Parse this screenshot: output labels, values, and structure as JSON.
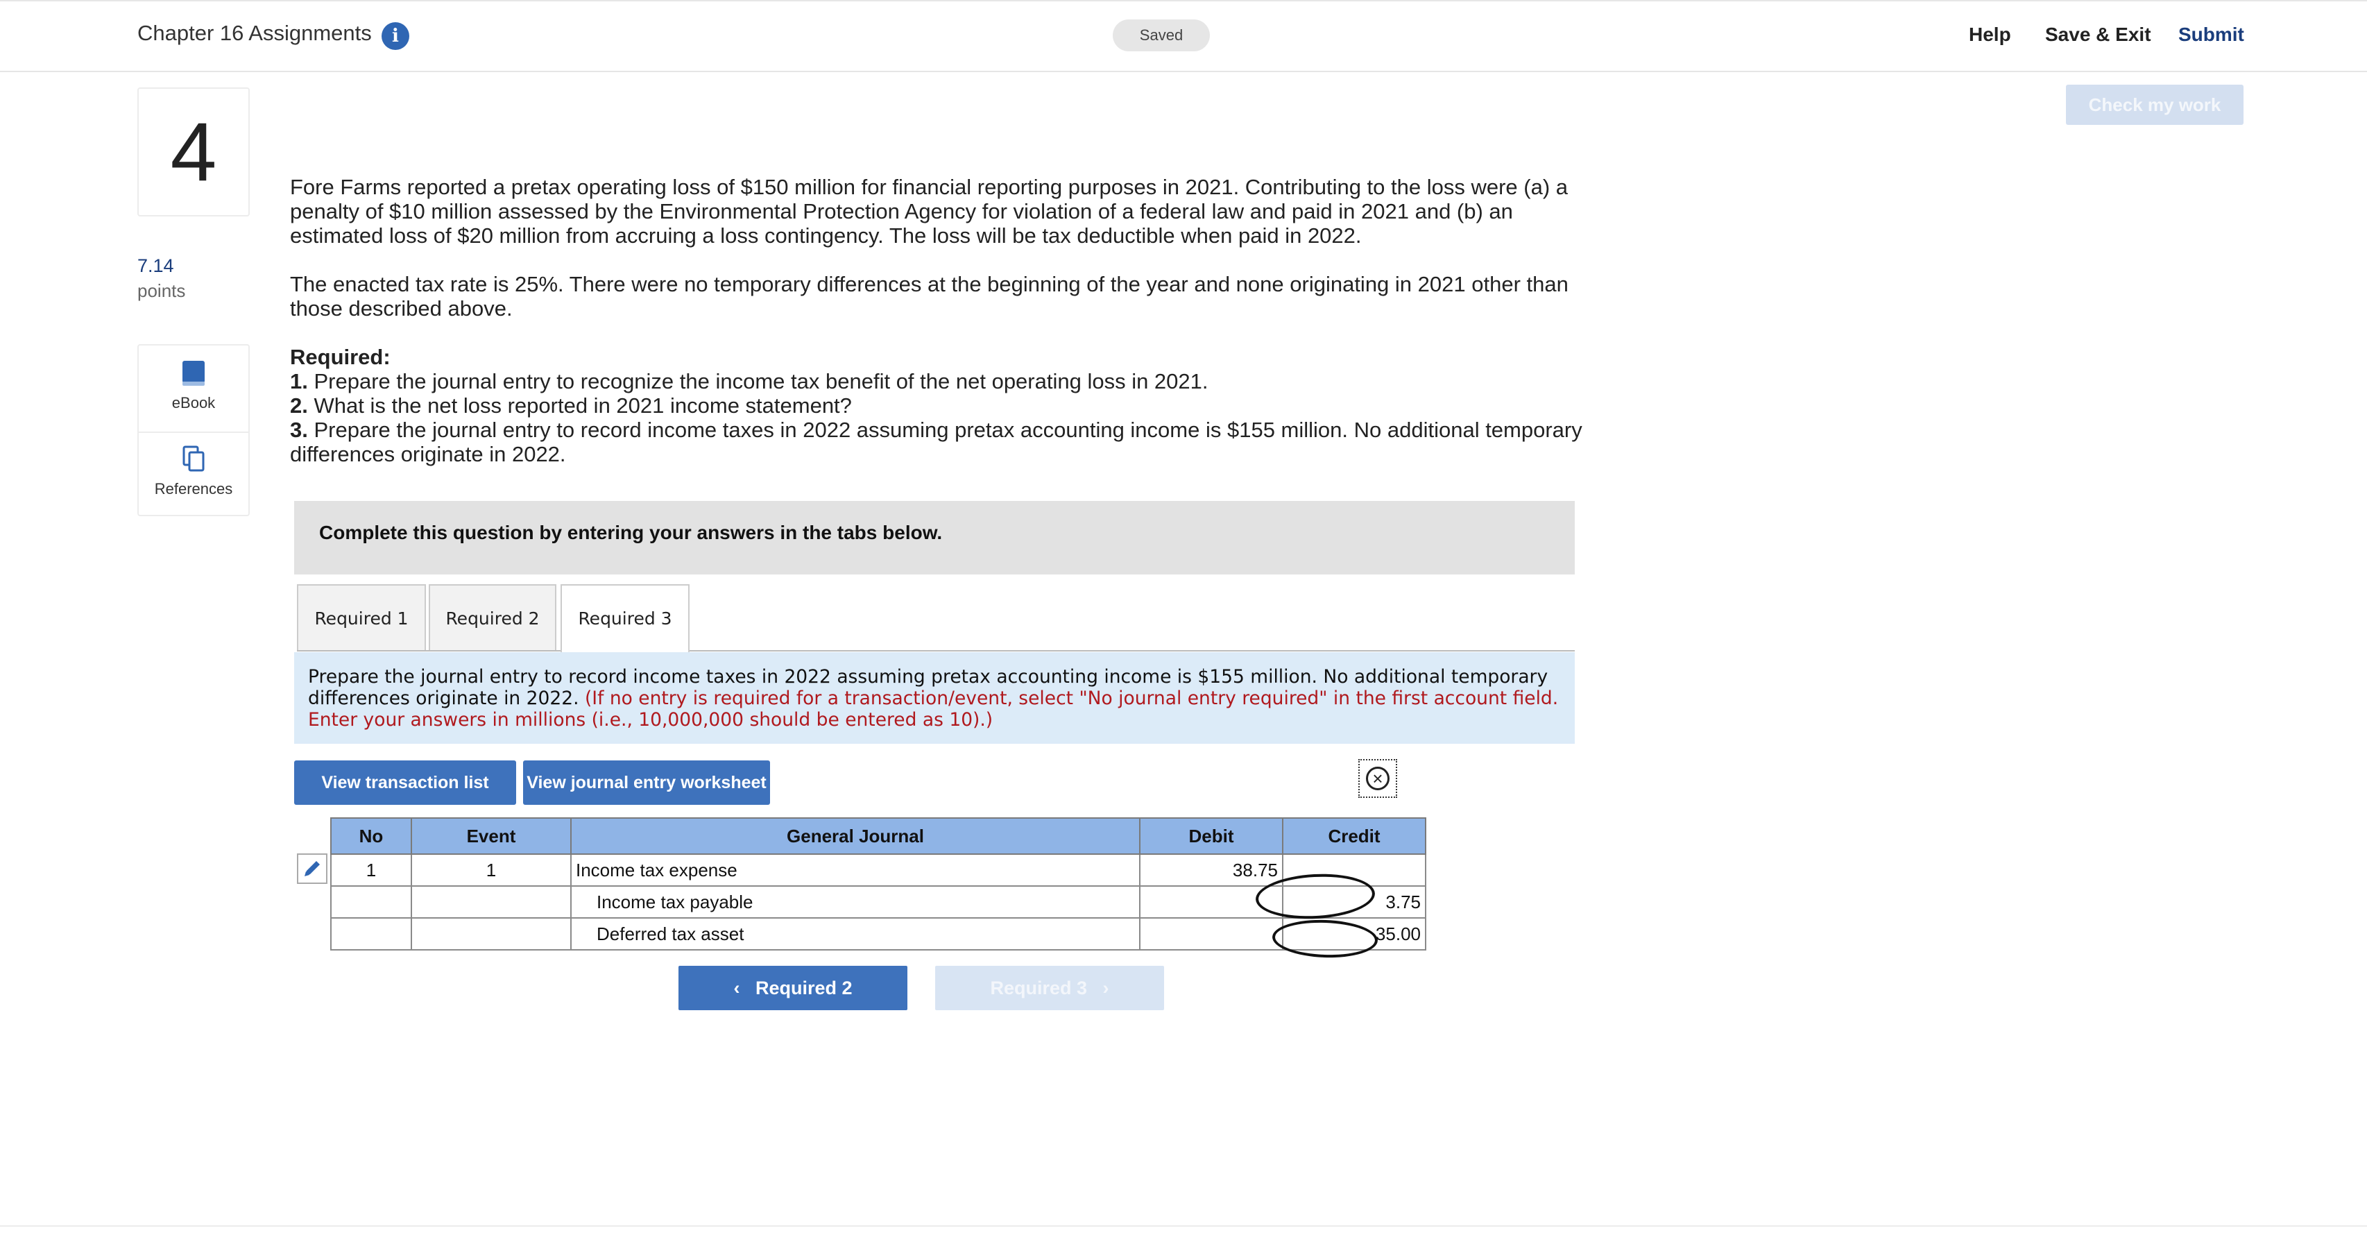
{
  "header": {
    "title": "Chapter 16 Assignments",
    "saved": "Saved",
    "help": "Help",
    "save_exit": "Save & Exit",
    "submit": "Submit"
  },
  "check_my_work": "Check my work",
  "question": {
    "number": "4",
    "points_value": "7.14",
    "points_label": "points",
    "tools": {
      "ebook": "eBook",
      "references": "References"
    },
    "para1": "Fore Farms reported a pretax operating loss of $150 million for financial reporting purposes in 2021. Contributing to the loss were (a) a penalty of $10 million assessed by the Environmental Protection Agency for violation of a federal law and paid in 2021 and (b) an estimated loss of $20 million from accruing a loss contingency. The loss will be tax deductible when paid in 2022.",
    "para2": "The enacted tax rate is 25%. There were no temporary differences at the beginning of the year and none originating in 2021 other than those described above.",
    "required_label": "Required:",
    "req1_num": "1.",
    "req1": "Prepare the journal entry to recognize the income tax benefit of the net operating loss in 2021.",
    "req2_num": "2.",
    "req2": "What is the net loss reported in 2021 income statement?",
    "req3_num": "3.",
    "req3": "Prepare the journal entry to record income taxes in 2022 assuming pretax accounting income is $155 million. No additional temporary differences originate in 2022."
  },
  "instruction": "Complete this question by entering your answers in the tabs below.",
  "tabs": [
    {
      "label": "Required 1"
    },
    {
      "label": "Required 2"
    },
    {
      "label": "Required 3"
    }
  ],
  "active_tab": "Required 3",
  "req_box": {
    "text": "Prepare the journal entry to record income taxes in 2022 assuming pretax accounting income is $155 million. No additional temporary differences originate in 2022.",
    "note": "(If no entry is required for a transaction/event, select \"No journal entry required\" in the first account field. Enter your answers in millions (i.e., 10,000,000 should be entered as 10).)"
  },
  "buttons": {
    "view_transaction_list": "View transaction list",
    "view_worksheet": "View journal entry worksheet"
  },
  "journal": {
    "headers": [
      "No",
      "Event",
      "General Journal",
      "Debit",
      "Credit"
    ],
    "rows": [
      {
        "no": "1",
        "event": "1",
        "account": "Income tax expense",
        "debit": "38.75",
        "credit": ""
      },
      {
        "no": "",
        "event": "",
        "account": "Income tax payable",
        "debit": "",
        "credit": "3.75"
      },
      {
        "no": "",
        "event": "",
        "account": "Deferred tax asset",
        "debit": "",
        "credit": "35.00"
      }
    ]
  },
  "nav": {
    "prev": "Required 2",
    "next": "Required 3"
  },
  "colors": {
    "accent": "#3e72bc",
    "table_header": "#8fb4e6",
    "note_red": "#b0191e",
    "brand_link": "#1a3d7c"
  }
}
